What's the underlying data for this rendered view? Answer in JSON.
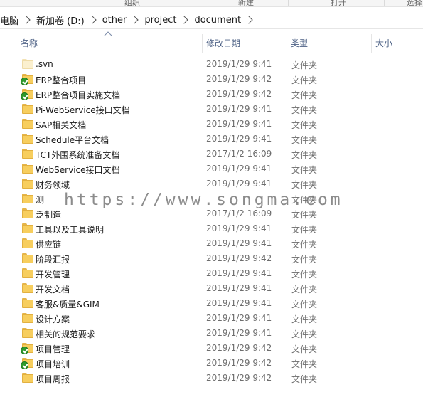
{
  "ribbon": {
    "labels": [
      "组织",
      "新建",
      "打开",
      "选择"
    ]
  },
  "breadcrumb": [
    "电脑",
    "新加卷 (D:)",
    "other",
    "project",
    "document"
  ],
  "columns": {
    "name": "名称",
    "date": "修改日期",
    "type": "类型",
    "size": "大小"
  },
  "files": [
    {
      "name": ".svn",
      "date": "2019/1/29 9:41",
      "type": "文件夹",
      "icon": "folder-hidden-icon",
      "synced": false
    },
    {
      "name": "ERP整合项目",
      "date": "2019/1/29 9:42",
      "type": "文件夹",
      "icon": "folder-icon",
      "synced": true
    },
    {
      "name": "ERP整合项目实施文档",
      "date": "2019/1/29 9:42",
      "type": "文件夹",
      "icon": "folder-icon",
      "synced": true
    },
    {
      "name": "Pi-WebService接口文档",
      "date": "2019/1/29 9:41",
      "type": "文件夹",
      "icon": "folder-icon",
      "synced": false
    },
    {
      "name": "SAP相关文档",
      "date": "2019/1/29 9:41",
      "type": "文件夹",
      "icon": "folder-icon",
      "synced": false
    },
    {
      "name": "Schedule平台文档",
      "date": "2019/1/29 9:41",
      "type": "文件夹",
      "icon": "folder-icon",
      "synced": false
    },
    {
      "name": "TCT外围系统准备文档",
      "date": "2017/1/2 16:09",
      "type": "文件夹",
      "icon": "folder-icon",
      "synced": false
    },
    {
      "name": "WebService接口文档",
      "date": "2019/1/29 9:41",
      "type": "文件夹",
      "icon": "folder-icon",
      "synced": false
    },
    {
      "name": "财务领域",
      "date": "2019/1/29 9:41",
      "type": "文件夹",
      "icon": "folder-icon",
      "synced": false
    },
    {
      "name": "测",
      "date": "",
      "type": "文件夹",
      "icon": "folder-icon",
      "synced": false
    },
    {
      "name": "泛制造",
      "date": "2017/1/2 16:09",
      "type": "文件夹",
      "icon": "folder-icon",
      "synced": false
    },
    {
      "name": "工具以及工具说明",
      "date": "2019/1/29 9:41",
      "type": "文件夹",
      "icon": "folder-icon",
      "synced": false
    },
    {
      "name": "供应链",
      "date": "2019/1/29 9:41",
      "type": "文件夹",
      "icon": "folder-icon",
      "synced": false
    },
    {
      "name": "阶段汇报",
      "date": "2019/1/29 9:42",
      "type": "文件夹",
      "icon": "folder-icon",
      "synced": false
    },
    {
      "name": "开发管理",
      "date": "2019/1/29 9:41",
      "type": "文件夹",
      "icon": "folder-icon",
      "synced": false
    },
    {
      "name": "开发文档",
      "date": "2019/1/29 9:41",
      "type": "文件夹",
      "icon": "folder-icon",
      "synced": false
    },
    {
      "name": "客服&质量&GIM",
      "date": "2019/1/29 9:41",
      "type": "文件夹",
      "icon": "folder-icon",
      "synced": false
    },
    {
      "name": "设计方案",
      "date": "2019/1/29 9:41",
      "type": "文件夹",
      "icon": "folder-icon",
      "synced": false
    },
    {
      "name": "相关的规范要求",
      "date": "2019/1/29 9:41",
      "type": "文件夹",
      "icon": "folder-icon",
      "synced": false
    },
    {
      "name": "项目管理",
      "date": "2019/1/29 9:42",
      "type": "文件夹",
      "icon": "folder-icon",
      "synced": true
    },
    {
      "name": "项目培训",
      "date": "2019/1/29 9:42",
      "type": "文件夹",
      "icon": "folder-icon",
      "synced": true
    },
    {
      "name": "项目周报",
      "date": "2019/1/29 9:42",
      "type": "文件夹",
      "icon": "folder-icon",
      "synced": false
    }
  ],
  "watermark": "https://www.songma.com"
}
